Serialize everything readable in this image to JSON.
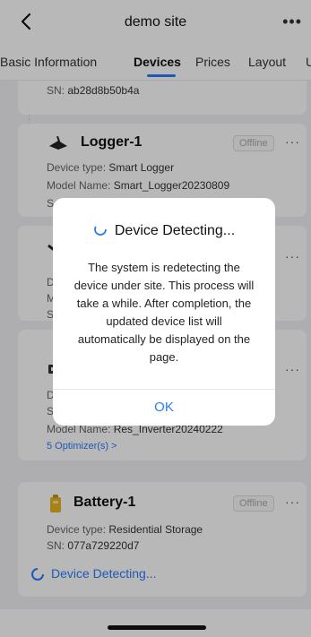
{
  "header": {
    "title": "demo site"
  },
  "tabs": [
    {
      "label": "Basic Information"
    },
    {
      "label": "Devices"
    },
    {
      "label": "Prices"
    },
    {
      "label": "Layout"
    },
    {
      "label": "U"
    }
  ],
  "devices": {
    "sn_top": {
      "label": "SN:",
      "value": "ab28d8b50b4a"
    },
    "logger": {
      "name": "Logger-1",
      "status": "Offline",
      "type_label": "Device type:",
      "type_value": "Smart Logger",
      "model_label": "Model Name:",
      "model_value": "Smart_Logger20230809",
      "sn_label": "S"
    },
    "inverter_partial": {
      "type_label": "Devi",
      "model_label": "Mod",
      "sn_label": "SN:"
    },
    "res_inverter": {
      "type_label": "Devi",
      "sn_label": "SN:",
      "model_label": "Model Name:",
      "model_value": "Res_Inverter20240222",
      "optimizers": "5 Optimizer(s) >"
    },
    "battery": {
      "name": "Battery-1",
      "status": "Offline",
      "type_label": "Device type:",
      "type_value": "Residential Storage",
      "sn_label": "SN:",
      "sn_value": "077a729220d7"
    }
  },
  "detecting_bar": {
    "label": "Device Detecting..."
  },
  "dialog": {
    "title": "Device Detecting...",
    "message": "The system is redetecting the device under site. This process will take a while. After completion, the updated device list will automatically be displayed on the page.",
    "ok_label": "OK"
  },
  "colors": {
    "accent": "#2a7bff",
    "battery": "#e8b423"
  }
}
